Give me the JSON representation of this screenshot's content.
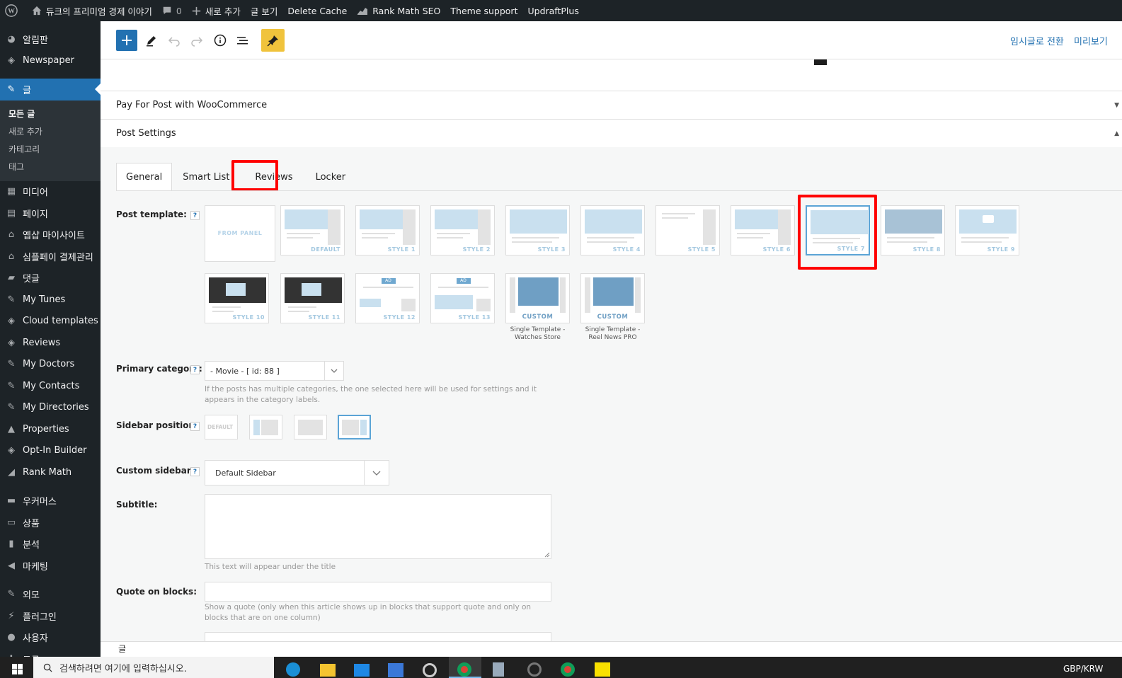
{
  "admin_bar": {
    "site_name": "듀크의 프리미엄 경제 이야기",
    "comments_count": "0",
    "new_label": "새로 추가",
    "view_post": "글 보기",
    "delete_cache": "Delete Cache",
    "rank_math": "Rank Math SEO",
    "theme_support": "Theme support",
    "updraft": "UpdraftPlus"
  },
  "sidebar": {
    "items_top": [
      {
        "label": "알림판",
        "icon": "dashboard-icon"
      },
      {
        "label": "Newspaper",
        "icon": "newspaper-icon"
      }
    ],
    "active": {
      "label": "글",
      "icon": "pin-icon"
    },
    "submenu": [
      "모든 글",
      "새로 추가",
      "카테고리",
      "태그"
    ],
    "items": [
      {
        "label": "미디어",
        "icon": "media-icon"
      },
      {
        "label": "페이지",
        "icon": "page-icon"
      },
      {
        "label": "옙샵 마이사이트",
        "icon": "shop-icon"
      },
      {
        "label": "심플페이 결제관리",
        "icon": "shop-icon"
      },
      {
        "label": "댓글",
        "icon": "comment-icon"
      },
      {
        "label": "My Tunes",
        "icon": "pin-icon"
      },
      {
        "label": "Cloud templates",
        "icon": "newspaper-icon"
      },
      {
        "label": "Reviews",
        "icon": "newspaper-icon"
      },
      {
        "label": "My Doctors",
        "icon": "pin-icon"
      },
      {
        "label": "My Contacts",
        "icon": "pin-icon"
      },
      {
        "label": "My Directories",
        "icon": "pin-icon"
      },
      {
        "label": "Properties",
        "icon": "building-icon"
      },
      {
        "label": "Opt-In Builder",
        "icon": "newspaper-icon"
      },
      {
        "label": "Rank Math",
        "icon": "chart-icon"
      }
    ],
    "items_bottom": [
      {
        "label": "우커머스",
        "icon": "woo-icon"
      },
      {
        "label": "상품",
        "icon": "archive-icon"
      },
      {
        "label": "분석",
        "icon": "bars-icon"
      },
      {
        "label": "마케팅",
        "icon": "megaphone-icon"
      }
    ],
    "items_bottom2": [
      {
        "label": "외모",
        "icon": "brush-icon"
      },
      {
        "label": "플러그인",
        "icon": "plugin-icon"
      },
      {
        "label": "사용자",
        "icon": "user-icon"
      },
      {
        "label": "도구",
        "icon": "tools-icon"
      }
    ]
  },
  "toolbar": {
    "switch_draft": "임시글로 전환",
    "preview": "미리보기"
  },
  "panels": {
    "pay_for_post": "Pay For Post with WooCommerce",
    "post_settings": "Post Settings"
  },
  "tabs": [
    "General",
    "Smart List",
    "Reviews",
    "Locker"
  ],
  "active_tab": "General",
  "fields": {
    "post_template_label": "Post template:",
    "primary_category_label": "Primary category:",
    "primary_category_value": "- Movie - [ id: 88 ]",
    "primary_category_help": "If the posts has multiple categories, the one selected here will be used for settings and it appears in the category labels.",
    "sidebar_position_label": "Sidebar position:",
    "sidebar_default": "DEFAULT",
    "custom_sidebar_label": "Custom sidebar:",
    "custom_sidebar_value": "Default Sidebar",
    "subtitle_label": "Subtitle:",
    "subtitle_help": "This text will appear under the title",
    "quote_label": "Quote on blocks:",
    "quote_help": "Show a quote (only when this article shows up in blocks that support quote and only on blocks that are on one column)",
    "help_mark": "?"
  },
  "templates": [
    {
      "name": "FROM PANEL"
    },
    {
      "name": "DEFAULT"
    },
    {
      "name": "STYLE 1"
    },
    {
      "name": "STYLE 2"
    },
    {
      "name": "STYLE 3"
    },
    {
      "name": "STYLE 4"
    },
    {
      "name": "STYLE 5"
    },
    {
      "name": "STYLE 6"
    },
    {
      "name": "STYLE 7",
      "selected": true
    },
    {
      "name": "STYLE 8"
    },
    {
      "name": "STYLE 9"
    },
    {
      "name": "STYLE 10"
    },
    {
      "name": "STYLE 11"
    },
    {
      "name": "STYLE 12"
    },
    {
      "name": "STYLE 13"
    },
    {
      "name": "CUSTOM",
      "caption": "Single Template - Watches Store"
    },
    {
      "name": "CUSTOM",
      "caption": "Single Template - Reel News PRO"
    }
  ],
  "ad_badge": "AD",
  "bottom_breadcrumb": "글",
  "taskbar": {
    "search_placeholder": "검색하려면 여기에 입력하십시오.",
    "tray_text": "GBP/KRW"
  },
  "colors": {
    "admin_bg": "#1d2327",
    "accent": "#2271b1",
    "highlight": "#ff0000",
    "pin_button": "#f0c33c"
  }
}
